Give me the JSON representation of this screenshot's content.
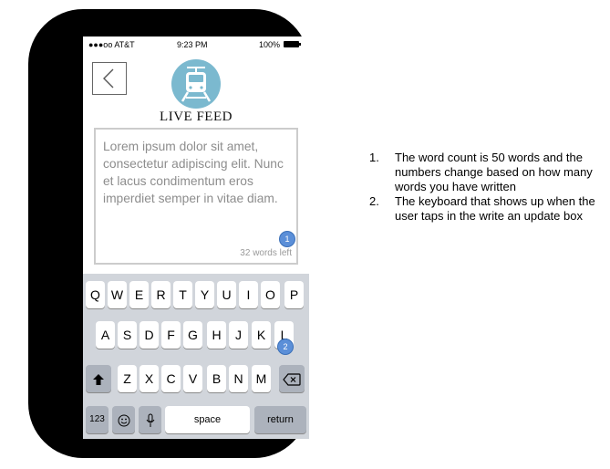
{
  "status_bar": {
    "carrier": "●●●oo AT&T",
    "time": "9:23 PM",
    "battery": "100%"
  },
  "header": {
    "back_icon": "chevron-left-icon",
    "logo_icon": "tram-icon",
    "title": "LIVE FEED"
  },
  "compose": {
    "text": "Lorem ipsum dolor sit amet, consectetur adipiscing elit. Nunc et lacus condimentum eros imperdiet semper in vitae diam.",
    "counter": "32 words left"
  },
  "markers": {
    "m1": "1",
    "m2": "2"
  },
  "keyboard": {
    "row1": [
      "Q",
      "W",
      "E",
      "R",
      "T",
      "Y",
      "U",
      "I",
      "O",
      "P"
    ],
    "row2": [
      "A",
      "S",
      "D",
      "F",
      "G",
      "H",
      "J",
      "K",
      "L"
    ],
    "row3": [
      "Z",
      "X",
      "C",
      "V",
      "B",
      "N",
      "M"
    ],
    "shift_icon": "shift-arrow-icon",
    "backspace_icon": "backspace-icon",
    "numbers": "123",
    "emoji_icon": "emoji-icon",
    "mic_icon": "microphone-icon",
    "space": "space",
    "return": "return"
  },
  "annotations": [
    {
      "number": "1.",
      "text": "The word count is 50 words and the numbers change based on how many words you have written"
    },
    {
      "number": "2.",
      "text": " The keyboard that shows up when the user taps in the write an update box"
    }
  ],
  "colors": {
    "logo": "#7bb9cf",
    "marker": "#5b8fd8",
    "keyboard_bg": "#d1d5db"
  }
}
